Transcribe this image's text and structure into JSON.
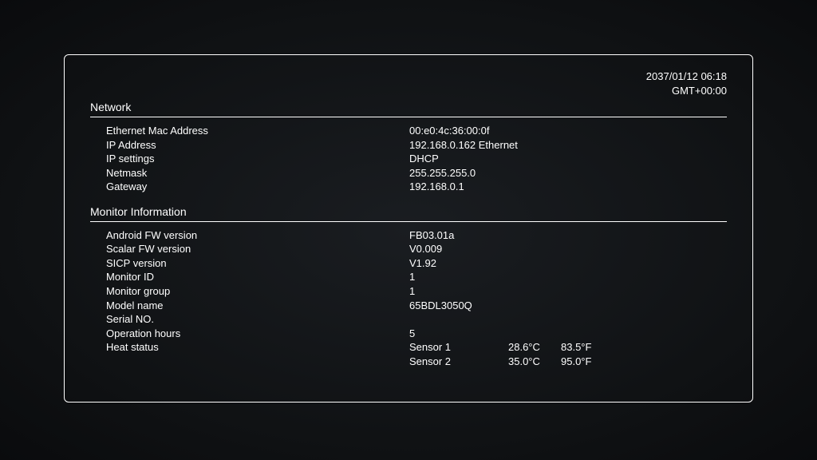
{
  "header": {
    "datetime": "2037/01/12 06:18",
    "timezone": "GMT+00:00"
  },
  "sections": {
    "network": {
      "title": "Network",
      "rows": {
        "mac_label": "Ethernet Mac Address",
        "mac_value": "00:e0:4c:36:00:0f",
        "ip_label": "IP Address",
        "ip_value": "192.168.0.162 Ethernet",
        "ipsettings_label": "IP settings",
        "ipsettings_value": "DHCP",
        "netmask_label": "Netmask",
        "netmask_value": "255.255.255.0",
        "gateway_label": "Gateway",
        "gateway_value": "192.168.0.1"
      }
    },
    "monitor": {
      "title": "Monitor Information",
      "rows": {
        "androidfw_label": "Android FW version",
        "androidfw_value": "FB03.01a",
        "scalarfw_label": "Scalar FW version",
        "scalarfw_value": "V0.009",
        "sicp_label": "SICP version",
        "sicp_value": "V1.92",
        "monitorid_label": "Monitor ID",
        "monitorid_value": "1",
        "monitorgroup_label": "Monitor group",
        "monitorgroup_value": "1",
        "model_label": "Model name",
        "model_value": "65BDL3050Q",
        "serial_label": "Serial NO.",
        "serial_value": "",
        "ophours_label": "Operation hours",
        "ophours_value": "5",
        "heat_label": "Heat status",
        "sensor1_name": "Sensor 1",
        "sensor1_c": "28.6°C",
        "sensor1_f": "83.5°F",
        "sensor2_name": "Sensor 2",
        "sensor2_c": "35.0°C",
        "sensor2_f": "95.0°F"
      }
    }
  }
}
